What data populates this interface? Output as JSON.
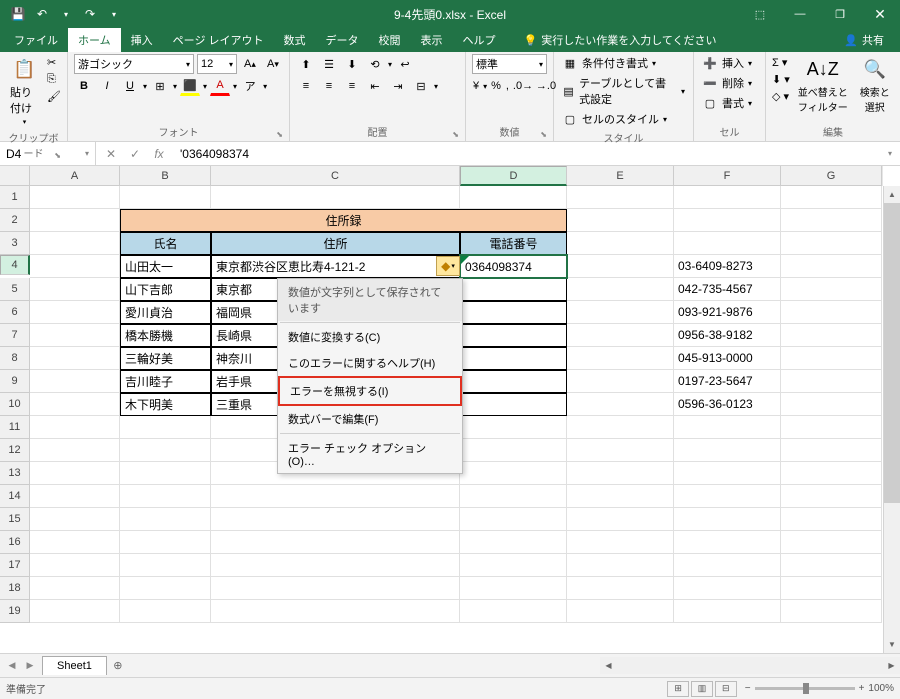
{
  "app": {
    "title": "9-4先頭0.xlsx - Excel"
  },
  "qat": {
    "save": "💾",
    "undo": "↶",
    "redo": "↷"
  },
  "win": {
    "ribbonOpts": "⬚",
    "min": "—",
    "max": "❐",
    "close": "✕"
  },
  "tabs": {
    "file": "ファイル",
    "home": "ホーム",
    "insert": "挿入",
    "layout": "ページ レイアウト",
    "formulas": "数式",
    "data": "データ",
    "review": "校閲",
    "view": "表示",
    "help": "ヘルプ",
    "tellme": "実行したい作業を入力してください",
    "share": "共有"
  },
  "ribbon": {
    "clipboard": {
      "label": "クリップボード",
      "paste": "貼り付け"
    },
    "font": {
      "label": "フォント",
      "name": "游ゴシック",
      "size": "12",
      "bold": "B",
      "italic": "I",
      "underline": "U"
    },
    "align": {
      "label": "配置"
    },
    "number": {
      "label": "数値",
      "format": "標準"
    },
    "styles": {
      "label": "スタイル",
      "cond": "条件付き書式",
      "table": "テーブルとして書式設定",
      "cell": "セルのスタイル"
    },
    "cells": {
      "label": "セル",
      "insert": "挿入",
      "delete": "削除",
      "format": "書式"
    },
    "editing": {
      "label": "編集",
      "sort": "並べ替えと\nフィルター",
      "find": "検索と\n選択"
    }
  },
  "formula": {
    "name": "D4",
    "value": "'0364098374",
    "fx": "fx",
    "cancel": "✕",
    "enter": "✓"
  },
  "cols": [
    "A",
    "B",
    "C",
    "D",
    "E",
    "F",
    "G"
  ],
  "table": {
    "title": "住所録",
    "h1": "氏名",
    "h2": "住所",
    "h3": "電話番号",
    "rows": [
      {
        "b": "山田太一",
        "c": "東京都渋谷区恵比寿4-121-2",
        "d": "0364098374",
        "f": "03-6409-8273"
      },
      {
        "b": "山下吉郎",
        "c": "東京都",
        "d": "",
        "f": "042-735-4567"
      },
      {
        "b": "愛川貞治",
        "c": "福岡県",
        "d": "",
        "f": "093-921-9876"
      },
      {
        "b": "橋本勝機",
        "c": "長崎県",
        "d": "",
        "f": "0956-38-9182"
      },
      {
        "b": "三輪好美",
        "c": "神奈川",
        "d": "",
        "f": "045-913-0000"
      },
      {
        "b": "吉川睦子",
        "c": "岩手県",
        "d": "",
        "f": "0197-23-5647"
      },
      {
        "b": "木下明美",
        "c": "三重県",
        "d": "",
        "f": "0596-36-0123"
      }
    ]
  },
  "smarttag": {
    "icon": "◆",
    "dd": "▾"
  },
  "ctxmenu": {
    "header": "数値が文字列として保存されています",
    "convert": "数値に変換する(C)",
    "help": "このエラーに関するヘルプ(H)",
    "ignore": "エラーを無視する(I)",
    "editfb": "数式バーで編集(F)",
    "options": "エラー チェック オプション(O)…"
  },
  "sheet": {
    "name": "Sheet1",
    "add": "⊕"
  },
  "status": {
    "ready": "準備完了",
    "zoom": "100%",
    "plus": "+",
    "minus": "−"
  }
}
